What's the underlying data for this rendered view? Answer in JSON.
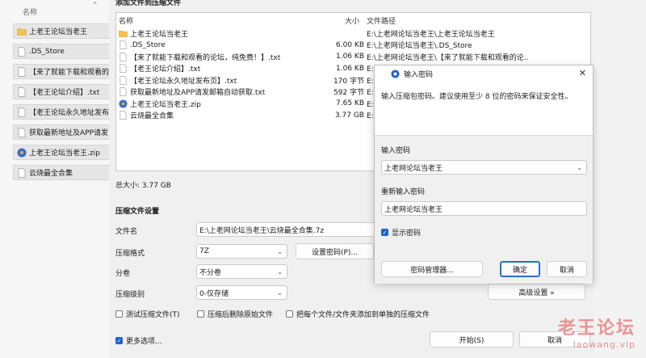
{
  "explorer": {
    "header": "名称",
    "items": [
      {
        "label": "上老王论坛当老王",
        "icon": "folder-icon"
      },
      {
        "label": ".DS_Store",
        "icon": "file-icon"
      },
      {
        "label": "【来了就能下载和观看的",
        "icon": "file-icon"
      },
      {
        "label": "【老王论坛介绍】.txt",
        "icon": "file-icon"
      },
      {
        "label": "【老王论坛永久地址发布",
        "icon": "file-icon"
      },
      {
        "label": "获取最新地址及APP请发",
        "icon": "file-icon"
      },
      {
        "label": "上老王论坛当老王.zip",
        "icon": "zip-icon"
      },
      {
        "label": "云烧最全合集",
        "icon": "file-icon"
      }
    ]
  },
  "main": {
    "section_title": "添加文件到压缩文件",
    "columns": {
      "name": "名称",
      "size": "大小",
      "path": "文件路径"
    },
    "files": [
      {
        "name": "上老王论坛当老王",
        "size": "",
        "path": "E:\\上老网论坛当老王\\上老王论坛当老王",
        "icon": "folder-icon"
      },
      {
        "name": ".DS_Store",
        "size": "6.00 KB",
        "path": "E:\\上老网论坛当老王\\.DS_Store",
        "icon": "file-icon"
      },
      {
        "name": "【来了就能下载和观看的论坛，纯免费！】.txt",
        "size": "1.06 KB",
        "path": "E:\\上老网论坛当老王\\【来了就能下载和观看的论...",
        "icon": "file-icon"
      },
      {
        "name": "【老王论坛介绍】.txt",
        "size": "1.06 KB",
        "path": "E:\\上老网论坛当老王\\【老王论坛介绍】.txt",
        "icon": "file-icon"
      },
      {
        "name": "【老王论坛永久地址发布页】.txt",
        "size": "170 字节",
        "path": "E:\\上老网论坛当老王\\【老王论坛永久地址发布页】.txt",
        "icon": "file-icon"
      },
      {
        "name": "获取最新地址及APP请发邮箱自动获取.txt",
        "size": "592 字节",
        "path": "E:\\上老网论坛当老王\\获取最新地址及APP请发邮箱自动获取.txt",
        "icon": "file-icon"
      },
      {
        "name": "上老王论坛当老王.zip",
        "size": "7.65 KB",
        "path": "E:\\上老网论坛当老王\\上老王论坛当老王.zip",
        "icon": "zip-icon"
      },
      {
        "name": "云烧最全合集",
        "size": "3.77 GB",
        "path": "E:\\上老网论坛当老王\\云烧最全合集",
        "icon": "file-icon"
      }
    ],
    "total": "总大小: 3.77 GB",
    "settings_title": "压缩文件设置",
    "filename_label": "文件名",
    "filename_value": "E:\\上老网论坛当老王\\云烧最全合集.7z",
    "format_label": "压缩格式",
    "format_value": "7Z",
    "set_password_btn": "设置密码(P)...",
    "split_label": "分卷",
    "split_value": "不分卷",
    "level_label": "压缩级别",
    "level_value": "0-仅存储",
    "advanced_btn": "高级设置 »",
    "chk_test": "测试压缩文件(T)",
    "chk_delete": "压缩后删除原始文件",
    "chk_each": "把每个文件/文件夹添加到单独的压缩文件",
    "chk_more": "更多选项...",
    "start_btn": "开始(S)",
    "cancel_btn": "取消"
  },
  "password_dialog": {
    "title": "输入密码",
    "description": "输入压缩包密码。建议使用至少 8 位的密码来保证安全性。",
    "pwd_label": "输入密码",
    "pwd_value": "上老网论坛当老王",
    "repeat_label": "重新输入密码",
    "repeat_value": "上老网论坛当老王",
    "show_password": "显示密码",
    "manager_btn": "密码管理器...",
    "ok_btn": "确定",
    "cancel_btn": "取消"
  },
  "watermark": {
    "big": "老王论坛",
    "small": "laowang.vip"
  },
  "colors": {
    "accent": "#1d64c9",
    "watermark": "#e04848"
  }
}
